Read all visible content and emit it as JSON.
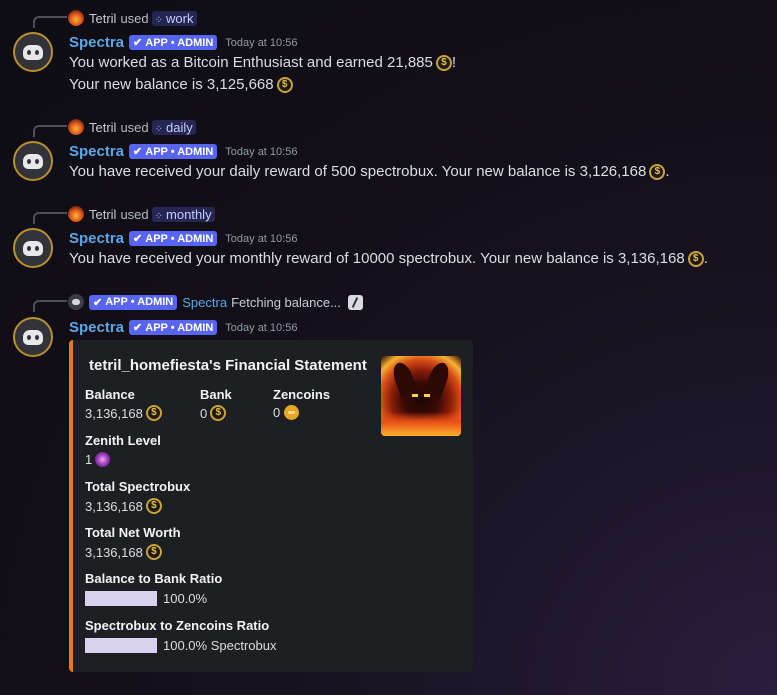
{
  "bot_name": "Spectra",
  "tag_label": "APP • ADMIN",
  "timestamp": "Today at 10:56",
  "messages": [
    {
      "reply_user": "Tetril",
      "reply_used": "used",
      "command": "work",
      "line1_pre": "You worked as a Bitcoin Enthusiast and earned 21,885",
      "line1_post": "!",
      "line2_pre": "Your new balance is 3,125,668"
    },
    {
      "reply_user": "Tetril",
      "reply_used": "used",
      "command": "daily",
      "line1_pre": "You have received your daily reward of 500 spectrobux. Your new balance is 3,126,168",
      "line1_post": "."
    },
    {
      "reply_user": "Tetril",
      "reply_used": "used",
      "command": "monthly",
      "line1_pre": "You have received your monthly reward of 10000 spectrobux. Your new balance is 3,136,168",
      "line1_post": "."
    }
  ],
  "interaction": {
    "reply_name": "Spectra",
    "reply_text": "Fetching balance..."
  },
  "embed": {
    "title": "tetril_homefiesta's Financial Statement",
    "balance_label": "Balance",
    "balance_value": "3,136,168",
    "bank_label": "Bank",
    "bank_value": "0",
    "zencoins_label": "Zencoins",
    "zencoins_value": "0",
    "zenith_label": "Zenith Level",
    "zenith_value": "1",
    "total_spectrobux_label": "Total Spectrobux",
    "total_spectrobux_value": "3,136,168",
    "net_worth_label": "Total Net Worth",
    "net_worth_value": "3,136,168",
    "bank_ratio_label": "Balance to Bank Ratio",
    "bank_ratio_value": "100.0%",
    "bank_ratio_fraction": 1.0,
    "zen_ratio_label": "Spectrobux to Zencoins Ratio",
    "zen_ratio_value": "100.0% Spectrobux",
    "zen_ratio_fraction": 1.0
  },
  "icons": {
    "coin": "spectrobux-coin-icon",
    "zencoin": "zencoin-icon",
    "zenith": "zenith-orb-icon",
    "edited": "slash-command-icon"
  },
  "colors": {
    "bot_name": "#5aa7e8",
    "tag": "#5865f2",
    "embed_accent": "#f0760e",
    "coin": "#c9a23a"
  }
}
